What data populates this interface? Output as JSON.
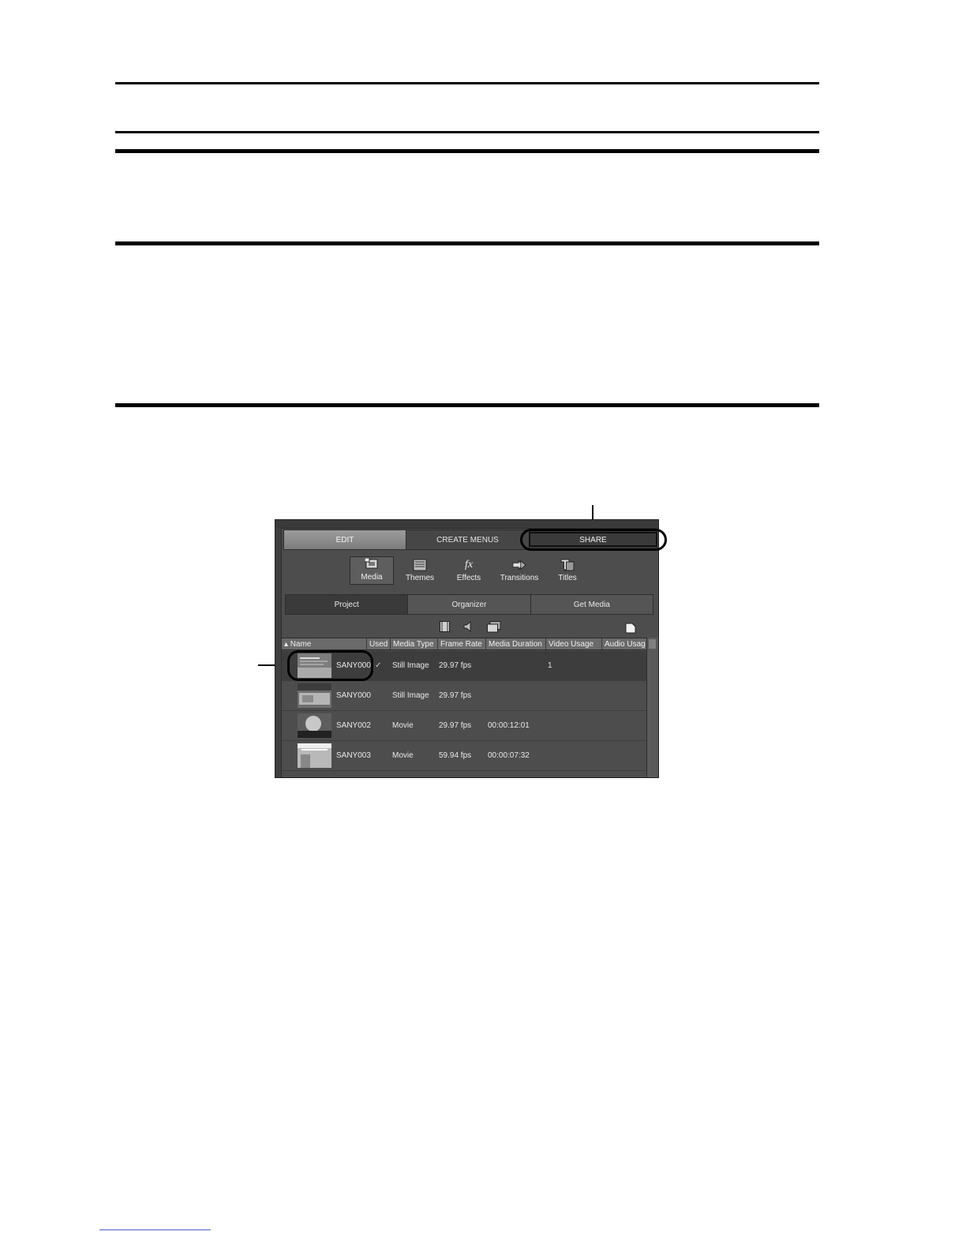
{
  "app": {
    "top_tabs": [
      {
        "label": "EDIT"
      },
      {
        "label": "CREATE MENUS"
      },
      {
        "label": "SHARE"
      }
    ],
    "tools": [
      {
        "label": "Media",
        "icon": "media-icon"
      },
      {
        "label": "Themes",
        "icon": "themes-icon"
      },
      {
        "label": "Effects",
        "icon": "fx-icon"
      },
      {
        "label": "Transitions",
        "icon": "transitions-icon"
      },
      {
        "label": "Titles",
        "icon": "titles-icon"
      }
    ],
    "effects_glyph": "fx",
    "sub_tabs": [
      {
        "label": "Project"
      },
      {
        "label": "Organizer"
      },
      {
        "label": "Get Media"
      }
    ],
    "columns": [
      "▴ Name",
      "Used",
      "Media Type",
      "Frame Rate",
      "Media Duration",
      "Video Usage",
      "Audio Usag"
    ],
    "rows": [
      {
        "name": "SANY000",
        "used": "✓",
        "media_type": "Still Image",
        "frame_rate": "29.97 fps",
        "duration": "",
        "video_usage": "1",
        "selected": true
      },
      {
        "name": "SANY000",
        "used": "",
        "media_type": "Still Image",
        "frame_rate": "29.97 fps",
        "duration": "",
        "video_usage": "",
        "selected": false
      },
      {
        "name": "SANY002",
        "used": "",
        "media_type": "Movie",
        "frame_rate": "29.97 fps",
        "duration": "00:00:12:01",
        "video_usage": "",
        "selected": false
      },
      {
        "name": "SANY003",
        "used": "",
        "media_type": "Movie",
        "frame_rate": "59.94 fps",
        "duration": "00:00:07:32",
        "video_usage": "",
        "selected": false
      }
    ]
  }
}
